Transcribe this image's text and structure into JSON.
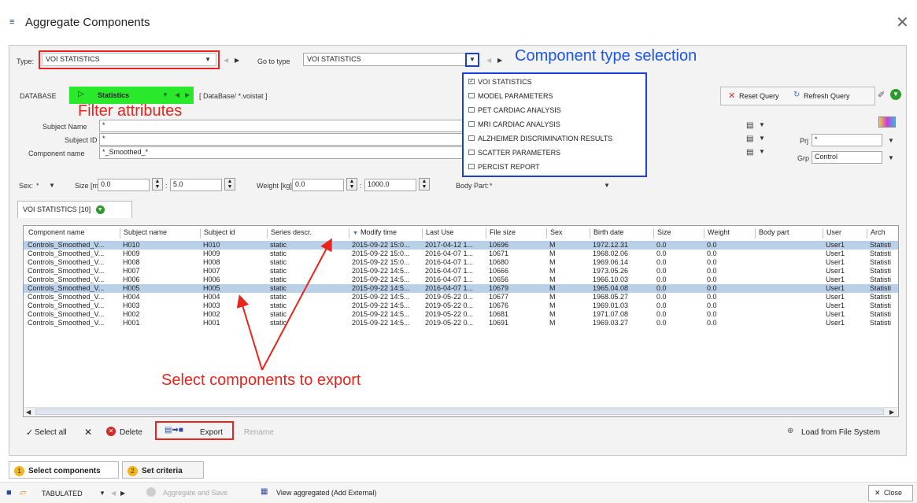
{
  "window": {
    "title": "Aggregate Components",
    "app_icon": "app-icon"
  },
  "type_row": {
    "type_label": "Type:",
    "type_value": "VOI STATISTICS",
    "goto_label": "Go to type",
    "goto_value": "VOI STATISTICS"
  },
  "annotations": {
    "component_type": "Component type selection",
    "filter": "Filter attributes",
    "select": "Select components to export"
  },
  "database_row": {
    "label": "DATABASE",
    "source": "Statistics",
    "path": "[ DataBase/ *.voistat ]",
    "reset_query": "Reset Query",
    "refresh_query": "Refresh Query"
  },
  "filters": {
    "subject_name_label": "Subject Name",
    "subject_name_value": "*",
    "subject_id_label": "Subject ID",
    "subject_id_value": "*",
    "component_name_label": "Component name",
    "component_name_value": "*_Smoothed_*",
    "prj_label": "Prj",
    "prj_value": "*",
    "grp_label": "Grp",
    "grp_value": "Control"
  },
  "range_row": {
    "sex_label": "Sex:",
    "sex_value": "*",
    "size_label": "Size [m]",
    "size_min": "0.0",
    "size_max": "5.0",
    "weight_label": "Weight [kg]",
    "weight_min": "0.0",
    "weight_max": "1000.0",
    "body_part_label": "Body Part:",
    "body_part_value": "*"
  },
  "type_dropdown": {
    "items": [
      {
        "label": "VOI STATISTICS",
        "checked": true
      },
      {
        "label": "MODEL PARAMETERS",
        "checked": false
      },
      {
        "label": "PET CARDIAC ANALYSIS",
        "checked": false
      },
      {
        "label": "MRI CARDIAC ANALYSIS",
        "checked": false
      },
      {
        "label": "ALZHEIMER DISCRIMINATION RESULTS",
        "checked": false
      },
      {
        "label": "SCATTER PARAMETERS",
        "checked": false
      },
      {
        "label": "PERCIST REPORT",
        "checked": false
      }
    ]
  },
  "result_tab": {
    "label": "VOI STATISTICS [10]"
  },
  "table": {
    "columns": [
      "Component name",
      "Subject name",
      "Subject id",
      "Series descr.",
      "Modify time",
      "Last Use",
      "File size",
      "Sex",
      "Birth date",
      "Size",
      "Weight",
      "Body part",
      "User",
      "Arch"
    ],
    "rows": [
      {
        "c": [
          "Controls_Smoothed_V...",
          "H010",
          "H010",
          "static",
          "2015-09-22 15:0...",
          "2017-04-12 1...",
          "10696",
          "M",
          "1972.12.31",
          "0.0",
          "0.0",
          "",
          "User1",
          "Statisti"
        ],
        "selected": true
      },
      {
        "c": [
          "Controls_Smoothed_V...",
          "H009",
          "H009",
          "static",
          "2015-09-22 15:0...",
          "2016-04-07 1...",
          "10671",
          "M",
          "1968.02.06",
          "0.0",
          "0.0",
          "",
          "User1",
          "Statisti"
        ],
        "selected": false
      },
      {
        "c": [
          "Controls_Smoothed_V...",
          "H008",
          "H008",
          "static",
          "2015-09-22 15:0...",
          "2016-04-07 1...",
          "10680",
          "M",
          "1969.06.14",
          "0.0",
          "0.0",
          "",
          "User1",
          "Statisti"
        ],
        "selected": false
      },
      {
        "c": [
          "Controls_Smoothed_V...",
          "H007",
          "H007",
          "static",
          "2015-09-22 14:5...",
          "2016-04-07 1...",
          "10666",
          "M",
          "1973.05.26",
          "0.0",
          "0.0",
          "",
          "User1",
          "Statisti"
        ],
        "selected": false
      },
      {
        "c": [
          "Controls_Smoothed_V...",
          "H006",
          "H006",
          "static",
          "2015-09-22 14:5...",
          "2016-04-07 1...",
          "10656",
          "M",
          "1966.10.03",
          "0.0",
          "0.0",
          "",
          "User1",
          "Statisti"
        ],
        "selected": false
      },
      {
        "c": [
          "Controls_Smoothed_V...",
          "H005",
          "H005",
          "static",
          "2015-09-22 14:5...",
          "2016-04-07 1...",
          "10679",
          "M",
          "1965.04.08",
          "0.0",
          "0.0",
          "",
          "User1",
          "Statisti"
        ],
        "selected": true
      },
      {
        "c": [
          "Controls_Smoothed_V...",
          "H004",
          "H004",
          "static",
          "2015-09-22 14:5...",
          "2019-05-22 0...",
          "10677",
          "M",
          "1968.05.27",
          "0.0",
          "0.0",
          "",
          "User1",
          "Statisti"
        ],
        "selected": false
      },
      {
        "c": [
          "Controls_Smoothed_V...",
          "H003",
          "H003",
          "static",
          "2015-09-22 14:5...",
          "2019-05-22 0...",
          "10676",
          "M",
          "1969.01.03",
          "0.0",
          "0.0",
          "",
          "User1",
          "Statisti"
        ],
        "selected": false
      },
      {
        "c": [
          "Controls_Smoothed_V...",
          "H002",
          "H002",
          "static",
          "2015-09-22 14:5...",
          "2019-05-22 0...",
          "10681",
          "M",
          "1971.07.08",
          "0.0",
          "0.0",
          "",
          "User1",
          "Statisti"
        ],
        "selected": false
      },
      {
        "c": [
          "Controls_Smoothed_V...",
          "H001",
          "H001",
          "static",
          "2015-09-22 14:5...",
          "2019-05-22 0...",
          "10691",
          "M",
          "1969.03.27",
          "0.0",
          "0.0",
          "",
          "User1",
          "Statisti"
        ],
        "selected": false
      }
    ]
  },
  "actions": {
    "select_all": "Select all",
    "delete": "Delete",
    "export": "Export",
    "rename": "Rename",
    "load_fs": "Load from File System"
  },
  "steps": {
    "step1_num": "1",
    "step1": "Select components",
    "step2_num": "2",
    "step2": "Set criteria"
  },
  "status": {
    "mode": "TABULATED",
    "aggregate_save": "Aggregate and Save",
    "view_aggregated": "View aggregated (Add External)",
    "close": "Close"
  },
  "colors": {
    "annotation_red": "#e8241c",
    "annotation_blue": "#1a55e8",
    "source_green": "#2ae82a",
    "selection_blue": "#b9d0e8"
  }
}
